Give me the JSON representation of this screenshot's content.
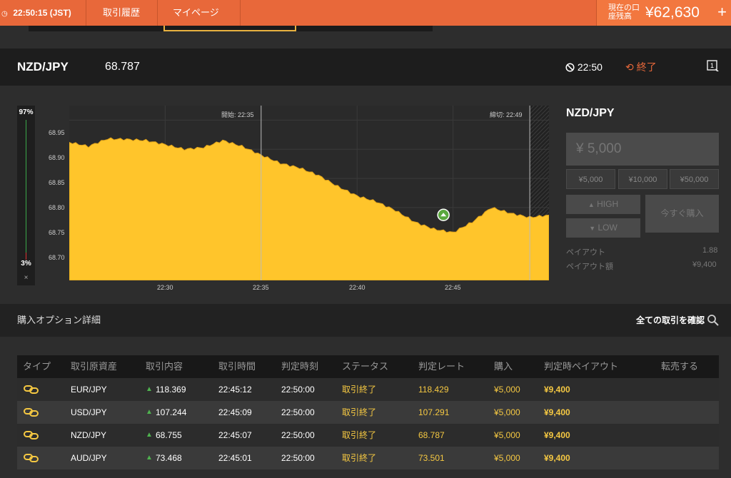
{
  "topbar": {
    "clock": "22:50:15 (JST)",
    "nav": [
      "取引履歴",
      "マイページ"
    ],
    "balance_label": "現在の口座残高",
    "balance_value": "¥62,630",
    "add_label": "+"
  },
  "asset": {
    "pair": "NZD/JPY",
    "price": "68.787",
    "timer": "22:50",
    "status": "終了"
  },
  "gauge": {
    "top_pct": "97%",
    "bottom_pct": "3%",
    "close_label": "×"
  },
  "chart_data": {
    "type": "area",
    "ytick_labels": [
      "68.95",
      "68.90",
      "68.85",
      "68.80",
      "68.75",
      "68.70"
    ],
    "xtick_labels": [
      "22:30",
      "22:35",
      "22:40",
      "22:45"
    ],
    "start_label": "開始: 22:35",
    "end_label": "締切: 22:49",
    "color": "#ffc52b",
    "x": [
      "22:25",
      "22:26",
      "22:27",
      "22:28",
      "22:29",
      "22:30",
      "22:31",
      "22:32",
      "22:33",
      "22:34",
      "22:35",
      "22:36",
      "22:37",
      "22:38",
      "22:39",
      "22:40",
      "22:41",
      "22:42",
      "22:43",
      "22:44",
      "22:45",
      "22:46",
      "22:47",
      "22:48",
      "22:49",
      "22:50"
    ],
    "y": [
      68.912,
      68.905,
      68.918,
      68.917,
      68.915,
      68.908,
      68.9,
      68.903,
      68.915,
      68.905,
      68.89,
      68.876,
      68.868,
      68.855,
      68.836,
      68.82,
      68.81,
      68.795,
      68.775,
      68.763,
      68.757,
      68.775,
      68.8,
      68.79,
      68.783,
      68.787
    ],
    "entry_time": "22:44:30",
    "entry_value": 68.78
  },
  "trade_panel": {
    "pair": "NZD/JPY",
    "amount_placeholder": "¥ 5,000",
    "amount_buttons": [
      "¥5,000",
      "¥10,000",
      "¥50,000"
    ],
    "high_label": "HIGH",
    "low_label": "LOW",
    "buy_now_label": "今すぐ購入",
    "payout_label": "ペイアウト",
    "payout_value": "1.88",
    "payout_amount_label": "ペイアウト額",
    "payout_amount_value": "¥9,400"
  },
  "details": {
    "title": "購入オプション詳細",
    "all_trades_label": "全ての取引を確認"
  },
  "table": {
    "headers": [
      "タイプ",
      "取引原資産",
      "取引内容",
      "取引時間",
      "判定時刻",
      "ステータス",
      "判定レート",
      "購入",
      "判定時ペイアウト",
      "転売する"
    ],
    "rows": [
      {
        "asset": "EUR/JPY",
        "rate": "118.369",
        "time": "22:45:12",
        "judge_time": "22:50:00",
        "status": "取引終了",
        "judge_rate": "118.429",
        "buy": "¥5,000",
        "payout": "¥9,400"
      },
      {
        "asset": "USD/JPY",
        "rate": "107.244",
        "time": "22:45:09",
        "judge_time": "22:50:00",
        "status": "取引終了",
        "judge_rate": "107.291",
        "buy": "¥5,000",
        "payout": "¥9,400"
      },
      {
        "asset": "NZD/JPY",
        "rate": "68.755",
        "time": "22:45:07",
        "judge_time": "22:50:00",
        "status": "取引終了",
        "judge_rate": "68.787",
        "buy": "¥5,000",
        "payout": "¥9,400"
      },
      {
        "asset": "AUD/JPY",
        "rate": "73.468",
        "time": "22:45:01",
        "judge_time": "22:50:00",
        "status": "取引終了",
        "judge_rate": "73.501",
        "buy": "¥5,000",
        "payout": "¥9,400"
      }
    ]
  }
}
